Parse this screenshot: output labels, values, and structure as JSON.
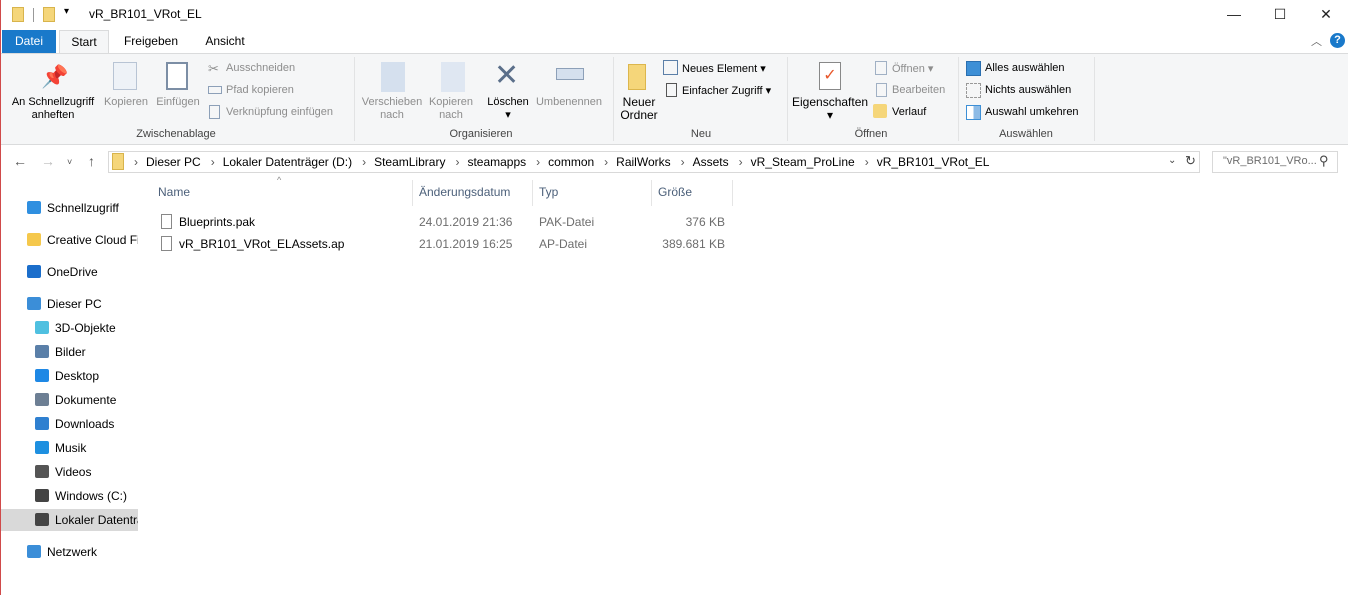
{
  "window": {
    "title": "vR_BR101_VRot_EL",
    "minimize": "—",
    "maximize": "☐",
    "close": "✕"
  },
  "tabs": [
    {
      "label": "Datei"
    },
    {
      "label": "Start"
    },
    {
      "label": "Freigeben"
    },
    {
      "label": "Ansicht"
    }
  ],
  "ribbon": {
    "clipboard": {
      "group": "Zwischenablage",
      "pin_l1": "An Schnellzugriff",
      "pin_l2": "anheften",
      "copy": "Kopieren",
      "paste": "Einfügen",
      "cut": "Ausschneiden",
      "copy_path": "Pfad kopieren",
      "paste_shortcut": "Verknüpfung einfügen"
    },
    "organize": {
      "group": "Organisieren",
      "move_l1": "Verschieben",
      "move_l2": "nach",
      "copyto_l1": "Kopieren",
      "copyto_l2": "nach",
      "delete": "Löschen",
      "rename": "Umbenennen"
    },
    "new": {
      "group": "Neu",
      "folder_l1": "Neuer",
      "folder_l2": "Ordner",
      "new_item": "Neues Element",
      "easy_access": "Einfacher Zugriff"
    },
    "open": {
      "group": "Öffnen",
      "properties": "Eigenschaften",
      "open": "Öffnen",
      "edit": "Bearbeiten",
      "history": "Verlauf"
    },
    "select": {
      "group": "Auswählen",
      "all": "Alles auswählen",
      "none": "Nichts auswählen",
      "invert": "Auswahl umkehren"
    }
  },
  "address": {
    "crumbs": [
      "Dieser PC",
      "Lokaler Datenträger (D:)",
      "SteamLibrary",
      "steamapps",
      "common",
      "RailWorks",
      "Assets",
      "vR_Steam_ProLine",
      "vR_BR101_VRot_EL"
    ],
    "search_placeholder": "\"vR_BR101_VRo..."
  },
  "sidebar": [
    {
      "label": "Schnellzugriff",
      "icon": "star-icon"
    },
    {
      "label": "Creative Cloud Fi",
      "icon": "creative-cloud-icon"
    },
    {
      "label": "OneDrive",
      "icon": "cloud-icon"
    },
    {
      "label": "Dieser PC",
      "icon": "computer-icon"
    },
    {
      "label": "3D-Objekte",
      "icon": "cube-icon"
    },
    {
      "label": "Bilder",
      "icon": "pictures-icon"
    },
    {
      "label": "Desktop",
      "icon": "desktop-icon"
    },
    {
      "label": "Dokumente",
      "icon": "documents-icon"
    },
    {
      "label": "Downloads",
      "icon": "download-icon"
    },
    {
      "label": "Musik",
      "icon": "music-icon"
    },
    {
      "label": "Videos",
      "icon": "video-icon"
    },
    {
      "label": "Windows (C:)",
      "icon": "drive-icon"
    },
    {
      "label": "Lokaler Datentra",
      "icon": "drive-icon",
      "selected": true
    },
    {
      "label": "Netzwerk",
      "icon": "network-icon"
    }
  ],
  "columns": [
    "Name",
    "Änderungsdatum",
    "Typ",
    "Größe"
  ],
  "files": [
    {
      "name": "Blueprints.pak",
      "date": "24.01.2019 21:36",
      "type": "PAK-Datei",
      "size": "376 KB"
    },
    {
      "name": "vR_BR101_VRot_ELAssets.ap",
      "date": "21.01.2019 16:25",
      "type": "AP-Datei",
      "size": "389.681 KB"
    }
  ],
  "colors": {
    "accent": "#1979ca",
    "selected": "#d9d9d9"
  }
}
